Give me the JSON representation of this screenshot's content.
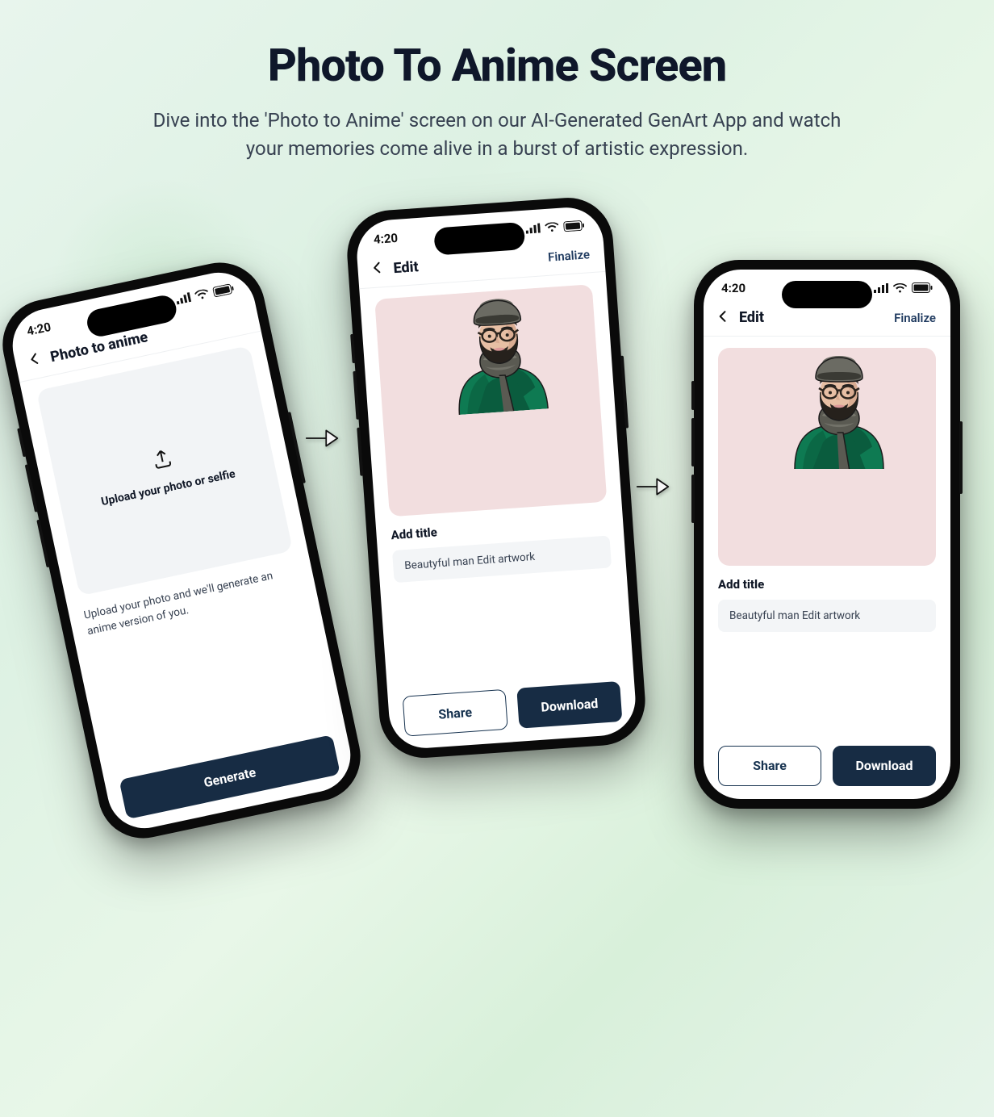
{
  "hero": {
    "title": "Photo To Anime Screen",
    "subtitle": "Dive into the 'Photo to Anime' screen on our AI-Generated GenArt App and watch your memories come alive in a burst of artistic expression."
  },
  "status": {
    "time": "4:20"
  },
  "phone_left": {
    "title": "Photo to anime",
    "upload_label": "Upload your photo or selfie",
    "helper": "Upload your photo and we'll generate an anime version of you.",
    "generate": "Generate"
  },
  "phone_center": {
    "title": "Edit",
    "finalize": "Finalize",
    "add_title_label": "Add title",
    "title_value": "Beautyful man Edit artwork",
    "share": "Share",
    "download": "Download"
  },
  "phone_right": {
    "title": "Edit",
    "finalize": "Finalize",
    "add_title_label": "Add title",
    "title_value": "Beautyful man Edit artwork",
    "share": "Share",
    "download": "Download"
  }
}
